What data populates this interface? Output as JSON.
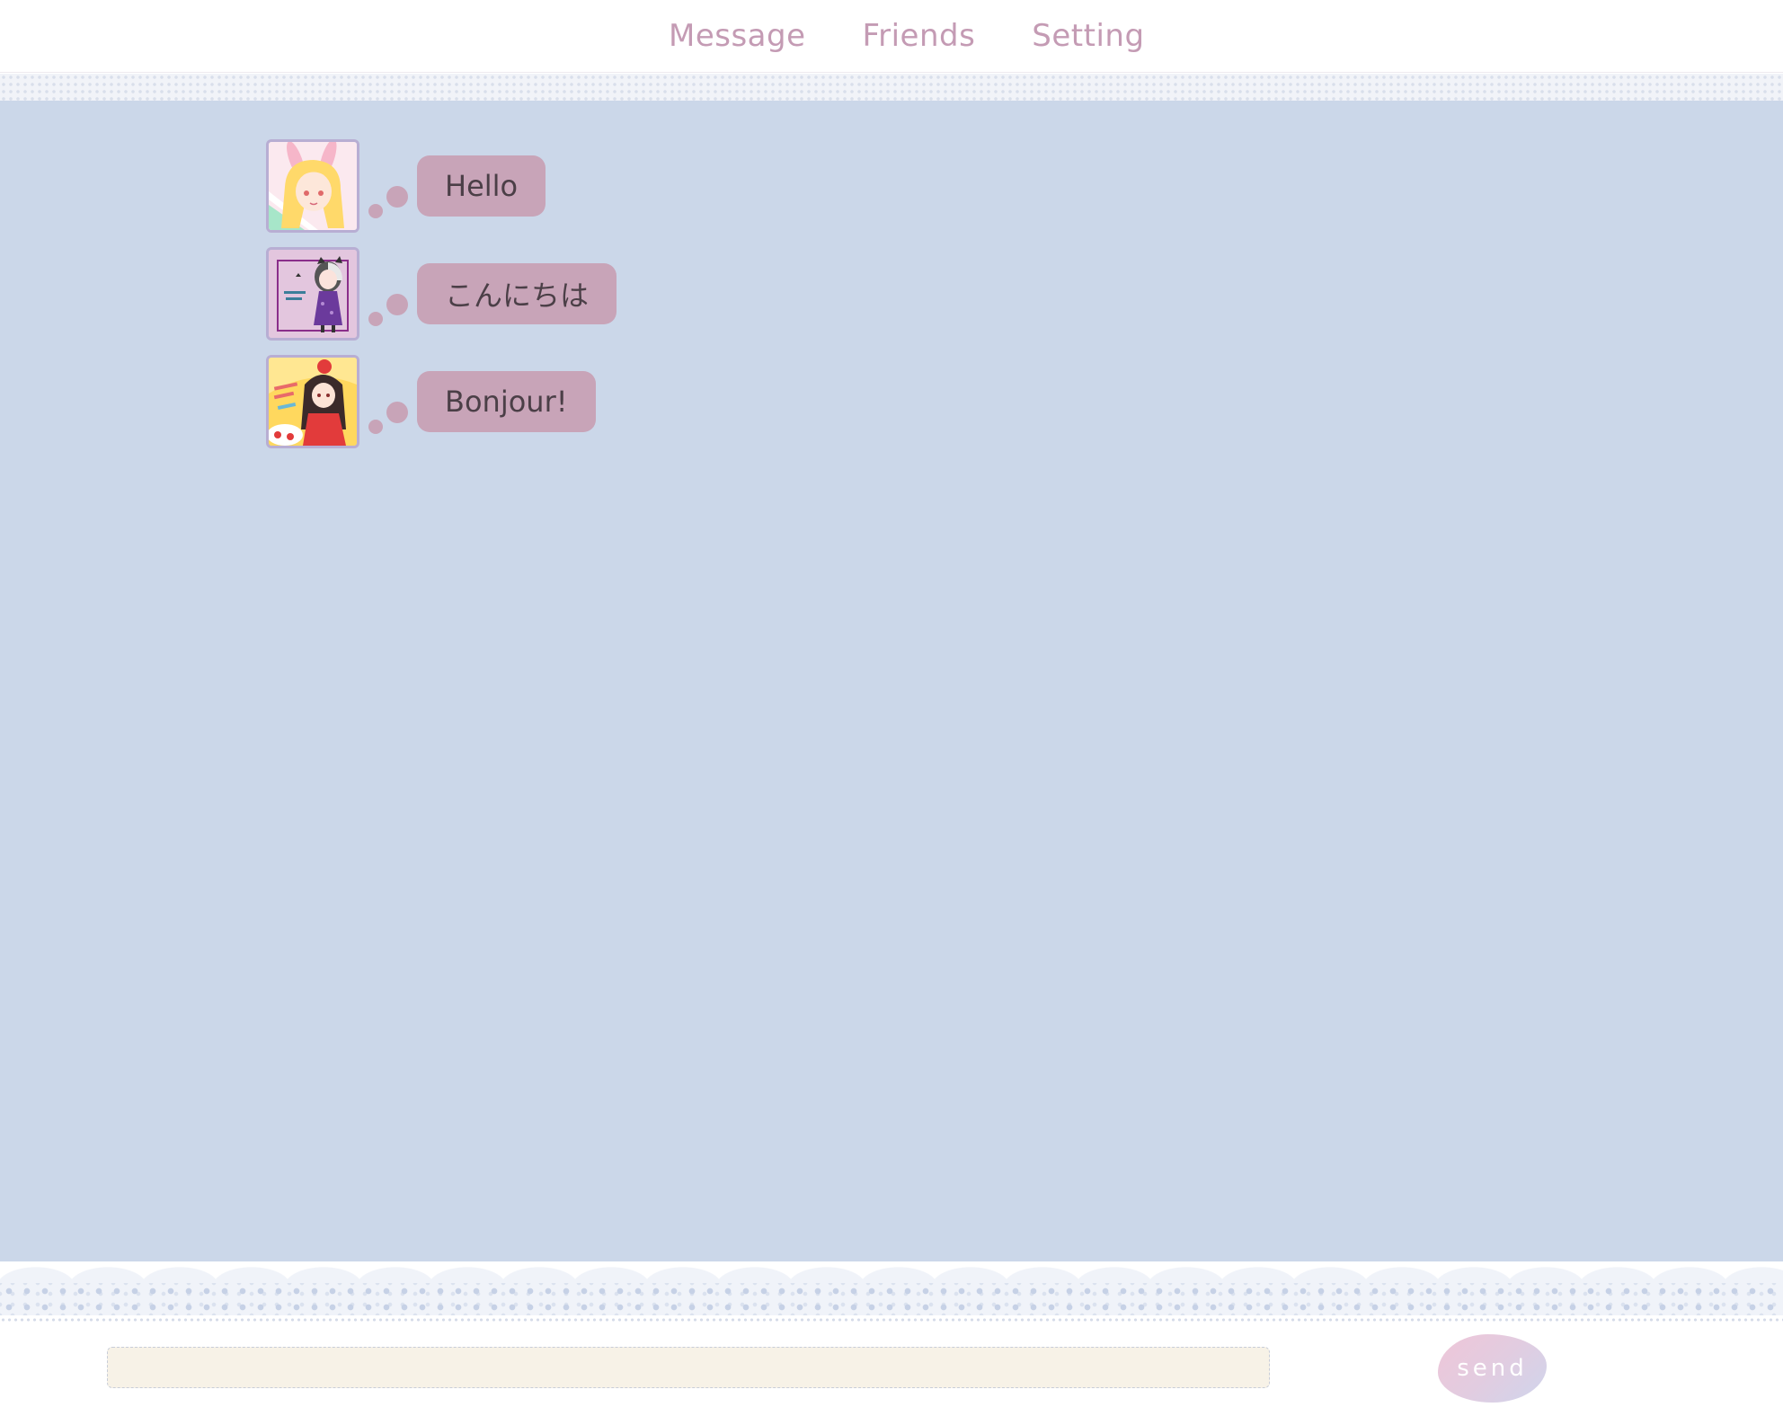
{
  "header": {
    "nav": [
      {
        "label": "Message"
      },
      {
        "label": "Friends"
      },
      {
        "label": "Setting"
      }
    ]
  },
  "messages": [
    {
      "text": "Hello",
      "avatar": "bunny-girl-avatar"
    },
    {
      "text": "こんにちは",
      "avatar": "spooky-doll-avatar"
    },
    {
      "text": "Bonjour!",
      "avatar": "red-dress-girl-avatar"
    }
  ],
  "footer": {
    "input_value": "",
    "send_label": "send"
  },
  "colors": {
    "chat_background": "#cbd7e9",
    "bubble": "#c8a4b8",
    "nav_text": "#c49bb4",
    "input_background": "#f7f2e7"
  }
}
